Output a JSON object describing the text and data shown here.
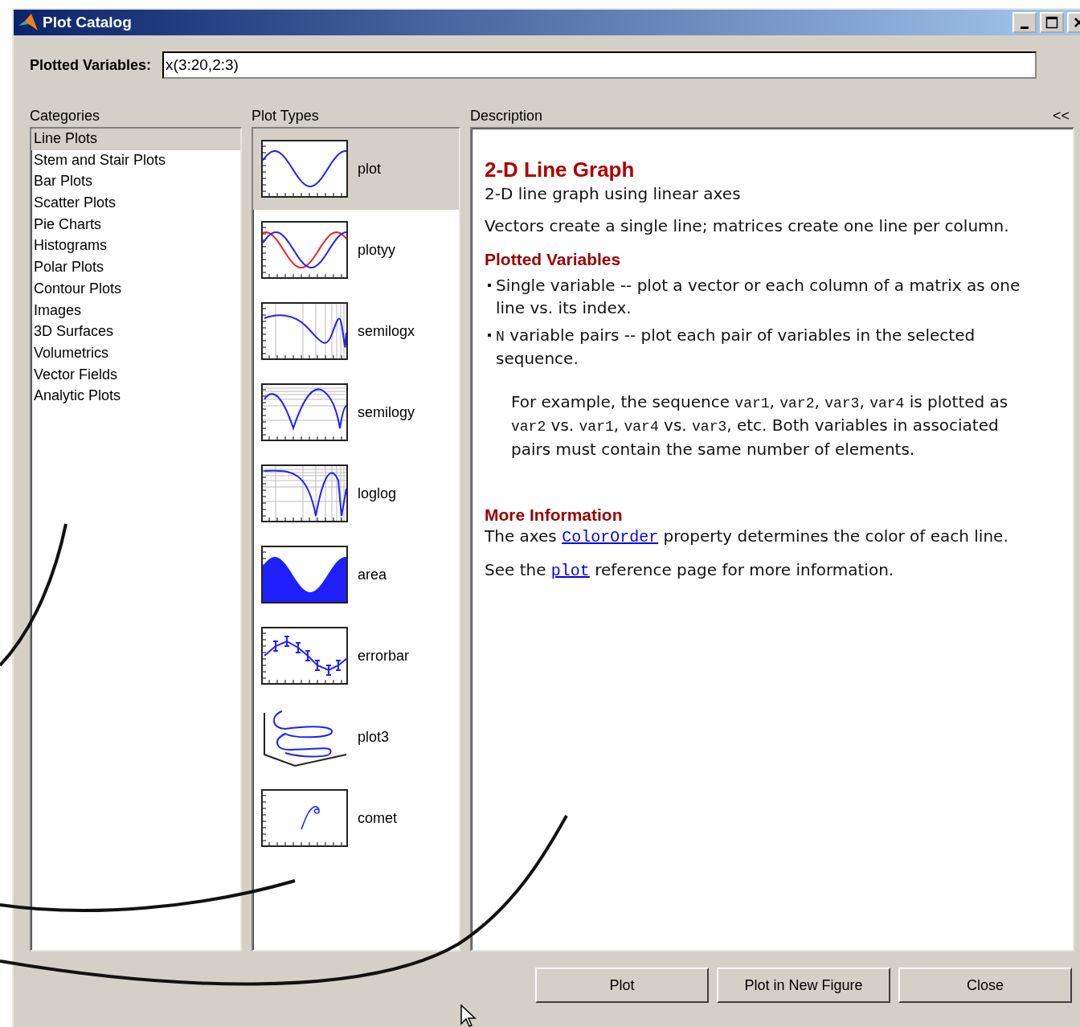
{
  "window": {
    "title": "Plot Catalog"
  },
  "plotted_variables": {
    "label": "Plotted Variables:",
    "value": "x(3:20,2:3)"
  },
  "categories": {
    "heading": "Categories",
    "items": [
      {
        "label": "Line Plots",
        "selected": true
      },
      {
        "label": "Stem and Stair Plots",
        "selected": false
      },
      {
        "label": "Bar Plots",
        "selected": false
      },
      {
        "label": "Scatter Plots",
        "selected": false
      },
      {
        "label": "Pie Charts",
        "selected": false
      },
      {
        "label": "Histograms",
        "selected": false
      },
      {
        "label": "Polar Plots",
        "selected": false
      },
      {
        "label": "Contour Plots",
        "selected": false
      },
      {
        "label": "Images",
        "selected": false
      },
      {
        "label": "3D Surfaces",
        "selected": false
      },
      {
        "label": "Volumetrics",
        "selected": false
      },
      {
        "label": "Vector Fields",
        "selected": false
      },
      {
        "label": "Analytic Plots",
        "selected": false
      }
    ]
  },
  "plot_types": {
    "heading": "Plot Types",
    "items": [
      {
        "label": "plot",
        "kind": "sine",
        "selected": true
      },
      {
        "label": "plotyy",
        "kind": "dual",
        "selected": false
      },
      {
        "label": "semilogx",
        "kind": "semilogx",
        "selected": false
      },
      {
        "label": "semilogy",
        "kind": "semilogy",
        "selected": false
      },
      {
        "label": "loglog",
        "kind": "loglog",
        "selected": false
      },
      {
        "label": "area",
        "kind": "area",
        "selected": false
      },
      {
        "label": "errorbar",
        "kind": "errorbar",
        "selected": false
      },
      {
        "label": "plot3",
        "kind": "helix",
        "selected": false
      },
      {
        "label": "comet",
        "kind": "comet",
        "selected": false
      }
    ]
  },
  "description": {
    "heading": "Description",
    "collapse": "<<",
    "title": "2-D Line Graph",
    "subtitle": "2-D line graph using linear axes",
    "summary": "Vectors create a single line; matrices create one line per column.",
    "plotted_variables": {
      "heading": "Plotted Variables",
      "bullets": [
        [
          {
            "kind": "text",
            "text": "Single variable -- plot a vector or each column of a matrix as one line vs. its index."
          }
        ],
        [
          {
            "kind": "code",
            "text": "N"
          },
          {
            "kind": "text",
            "text": " variable pairs -- plot each pair of variables in the selected sequence."
          }
        ]
      ],
      "example": [
        {
          "kind": "text",
          "text": "For example, the sequence "
        },
        {
          "kind": "code",
          "text": "var1"
        },
        {
          "kind": "text",
          "text": ", "
        },
        {
          "kind": "code",
          "text": "var2"
        },
        {
          "kind": "text",
          "text": ", "
        },
        {
          "kind": "code",
          "text": "var3"
        },
        {
          "kind": "text",
          "text": ", "
        },
        {
          "kind": "code",
          "text": "var4"
        },
        {
          "kind": "text",
          "text": " is plotted as "
        },
        {
          "kind": "code",
          "text": "var2"
        },
        {
          "kind": "text",
          "text": " vs. "
        },
        {
          "kind": "code",
          "text": "var1"
        },
        {
          "kind": "text",
          "text": ", "
        },
        {
          "kind": "code",
          "text": "var4"
        },
        {
          "kind": "text",
          "text": " vs. "
        },
        {
          "kind": "code",
          "text": "var3"
        },
        {
          "kind": "text",
          "text": ", etc. Both variables in associated pairs must contain the same number of elements."
        }
      ]
    },
    "more_information": {
      "heading": "More Information",
      "paragraphs": [
        [
          {
            "kind": "text",
            "text": "The axes "
          },
          {
            "kind": "link",
            "text": "ColorOrder"
          },
          {
            "kind": "text",
            "text": " property determines the color of each line."
          }
        ],
        [
          {
            "kind": "text",
            "text": "See the "
          },
          {
            "kind": "link",
            "text": "plot"
          },
          {
            "kind": "text",
            "text": " reference page for more information."
          }
        ]
      ]
    }
  },
  "buttons": [
    "Plot",
    "Plot in New Figure",
    "Close"
  ]
}
